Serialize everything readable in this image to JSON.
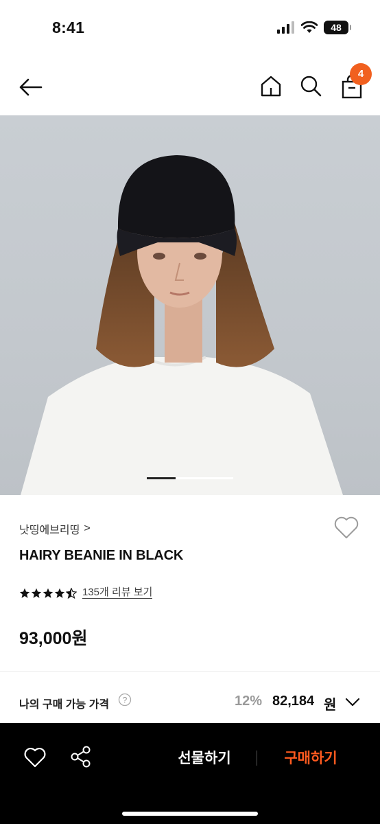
{
  "status_bar": {
    "time": "8:41",
    "battery": "48"
  },
  "nav": {
    "cart_count": "4"
  },
  "gallery": {
    "current_page": 1,
    "total_pages": 3
  },
  "product": {
    "brand": "낫띵에브리띵",
    "brand_chevron": ">",
    "name": "HAIRY BEANIE IN BLACK",
    "rating": 4.5,
    "review_link": "135개 리뷰 보기",
    "price": "93,000원"
  },
  "my_price": {
    "label": "나의 구매 가능 가격",
    "discount": "12%",
    "amount": "82,184",
    "unit": "원"
  },
  "bottom_bar": {
    "gift_label": "선물하기",
    "buy_label": "구매하기"
  },
  "colors": {
    "accent": "#ff5a1f",
    "badge": "#f1601f",
    "bottom_bar": "#000000"
  }
}
